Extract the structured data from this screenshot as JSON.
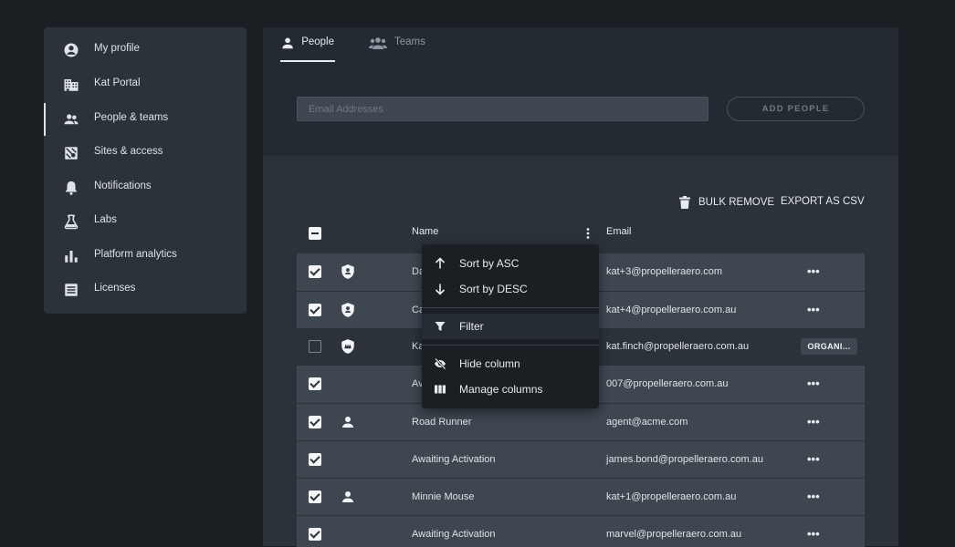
{
  "sidebar": {
    "items": [
      {
        "label": "My profile",
        "icon": "account-circle-icon"
      },
      {
        "label": "Kat Portal",
        "icon": "building-icon"
      },
      {
        "label": "People & teams",
        "icon": "people-icon",
        "active": true
      },
      {
        "label": "Sites & access",
        "icon": "map-icon"
      },
      {
        "label": "Notifications",
        "icon": "bell-icon"
      },
      {
        "label": "Labs",
        "icon": "flask-icon"
      },
      {
        "label": "Platform analytics",
        "icon": "bar-chart-icon"
      },
      {
        "label": "Licenses",
        "icon": "license-icon"
      }
    ]
  },
  "tabs": {
    "people": "People",
    "teams": "Teams"
  },
  "invite": {
    "placeholder": "Email Addresses",
    "add_label": "ADD PEOPLE"
  },
  "actions": {
    "bulk_remove": "BULK REMOVE",
    "export_csv": "EXPORT AS CSV"
  },
  "table": {
    "headers": {
      "name": "Name",
      "email": "Email"
    },
    "rows": [
      {
        "name": "Da",
        "email": "kat+3@propelleraero.com",
        "checked": true,
        "type": "admin-shield-icon",
        "action": "more"
      },
      {
        "name": "Ca",
        "email": "kat+4@propelleraero.com.au",
        "checked": true,
        "type": "admin-shield-icon",
        "action": "more"
      },
      {
        "name": "Ka",
        "email": "kat.finch@propelleraero.com.au",
        "checked": false,
        "type": "org-shield-icon",
        "action": "ORGANI..."
      },
      {
        "name": "Av",
        "email": "007@propelleraero.com.au",
        "checked": true,
        "type": "",
        "action": "more"
      },
      {
        "name": "Road Runner",
        "email": "agent@acme.com",
        "checked": true,
        "type": "person-icon",
        "action": "more"
      },
      {
        "name": "Awaiting Activation",
        "email": "james.bond@propelleraero.com.au",
        "checked": true,
        "type": "",
        "action": "more"
      },
      {
        "name": "Minnie Mouse",
        "email": "kat+1@propelleraero.com.au",
        "checked": true,
        "type": "person-icon",
        "action": "more"
      },
      {
        "name": "Awaiting Activation",
        "email": "marvel@propelleraero.com.au",
        "checked": true,
        "type": "",
        "action": "more"
      }
    ],
    "more_glyph": "•••"
  },
  "column_menu": {
    "sort_asc": "Sort by ASC",
    "sort_desc": "Sort by DESC",
    "filter": "Filter",
    "hide_column": "Hide column",
    "manage_columns": "Manage columns"
  }
}
